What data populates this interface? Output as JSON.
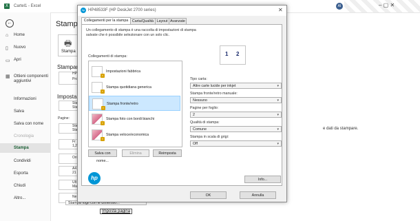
{
  "excel": {
    "doc_title": "Cartel1 - Excel",
    "avatar_initials": "AI",
    "window_controls": "–   ▢   ✕",
    "nav": [
      {
        "label": "Home",
        "icon": "home-icon",
        "glyph": "⌂"
      },
      {
        "label": "Nuovo",
        "icon": "new-file-icon",
        "glyph": "▯"
      },
      {
        "label": "Apri",
        "icon": "folder-icon",
        "glyph": "▭"
      },
      {
        "label": "Ottieni componenti aggiuntivi",
        "icon": "store-icon",
        "glyph": "▦"
      },
      {
        "label": "Informazioni"
      },
      {
        "label": "Salva"
      },
      {
        "label": "Salva con nome"
      },
      {
        "label": "Cronologia"
      },
      {
        "label": "Stampa"
      },
      {
        "label": "Condividi"
      },
      {
        "label": "Esporta"
      },
      {
        "label": "Chiudi"
      },
      {
        "label": "Altro..."
      }
    ],
    "page_title": "Stampa",
    "print_button": "Stampa",
    "printer_section": "Stampant",
    "settings_section": "Impostazi",
    "pages_label": "Pagine:",
    "options": [
      {
        "line1": "Sta",
        "line2": "Sta"
      },
      {
        "line1": "Sta",
        "line2": "Sta"
      },
      {
        "line1": "Fr",
        "line2": "1,2"
      },
      {
        "line1": "Ori",
        "line2": ""
      },
      {
        "line1": "A4",
        "line2": "21"
      },
      {
        "line1": "Ult",
        "line2": "Ma"
      },
      {
        "line1": "Ne",
        "line2": ""
      }
    ],
    "printer_short": "HP",
    "printer_sub": "Pro",
    "preview_message": "e dati da stampare.",
    "paper_dimension_row": "Stampa fogli con le dimensio...",
    "page_setup_link": "Imposta pagina"
  },
  "dialog": {
    "title": "HP48533F (HP DeskJet 2700 series)",
    "tabs": [
      "Collegamenti per la stampa",
      "Carta/Qualità",
      "Layout",
      "Avanzate"
    ],
    "description": "Un collegamento di stampa è una raccolta di impostazioni di stampa salvate che è possibile selezionare con un solo clic.",
    "list_label": "Collegamenti di stampa:",
    "shortcuts": [
      "Impostazioni fabbrica",
      "Stampa quotidiana generica",
      "Stampa fronte/retro",
      "Stampa foto con bordi bianchi",
      "Stampa veloce/economica"
    ],
    "selected_shortcut": "Stampa fronte/retro",
    "page_preview": [
      "1",
      "2"
    ],
    "fields": [
      {
        "label": "Tipo carta:",
        "value": "Altre carte lucide per inkjet"
      },
      {
        "label": "Stampa fronte/retro manuale:",
        "value": "Nessuno"
      },
      {
        "label": "Pagine per foglio:",
        "value": "2"
      },
      {
        "label": "Qualità di stampa:",
        "value": "Comune"
      },
      {
        "label": "Stampa in scala di grigi:",
        "value": "Off"
      }
    ],
    "buttons": {
      "save_as": "Salva con nome...",
      "delete": "Elimina",
      "reset": "Reimposta",
      "info": "Info...",
      "ok": "OK",
      "cancel": "Annulla"
    },
    "hp_logo": "hp"
  },
  "colors": {
    "excel_green": "#217346",
    "hp_blue": "#0096d6",
    "selection": "#cce8ff"
  }
}
